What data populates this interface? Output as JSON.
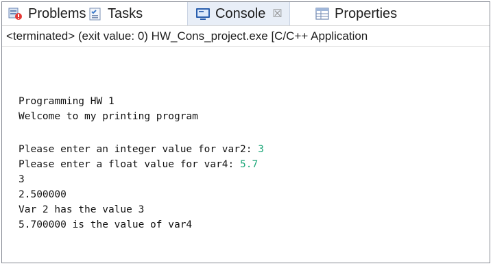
{
  "tabs": [
    {
      "label": "Problems",
      "icon": "problems-icon",
      "active": false
    },
    {
      "label": "Tasks",
      "icon": "tasks-icon",
      "active": false
    },
    {
      "label": "Console",
      "icon": "console-icon",
      "active": true,
      "close_glyph": "☒"
    },
    {
      "label": "Properties",
      "icon": "properties-icon",
      "active": false
    }
  ],
  "console_header": "<terminated> (exit value: 0) HW_Cons_project.exe [C/C++ Application",
  "output": {
    "line1": "Programming HW 1",
    "line2": "Welcome to my printing program",
    "prompt1": "Please enter an integer value for var2: ",
    "input1": "3",
    "prompt2": "Please enter a float value for var4: ",
    "input2": "5.7",
    "line5": "3",
    "line6": "2.500000",
    "line7": "Var 2 has the value 3",
    "line8": "5.700000 is the value of var4"
  },
  "colors": {
    "user_input": "#1fa87a",
    "active_tab_bg": "#e8eef7"
  }
}
